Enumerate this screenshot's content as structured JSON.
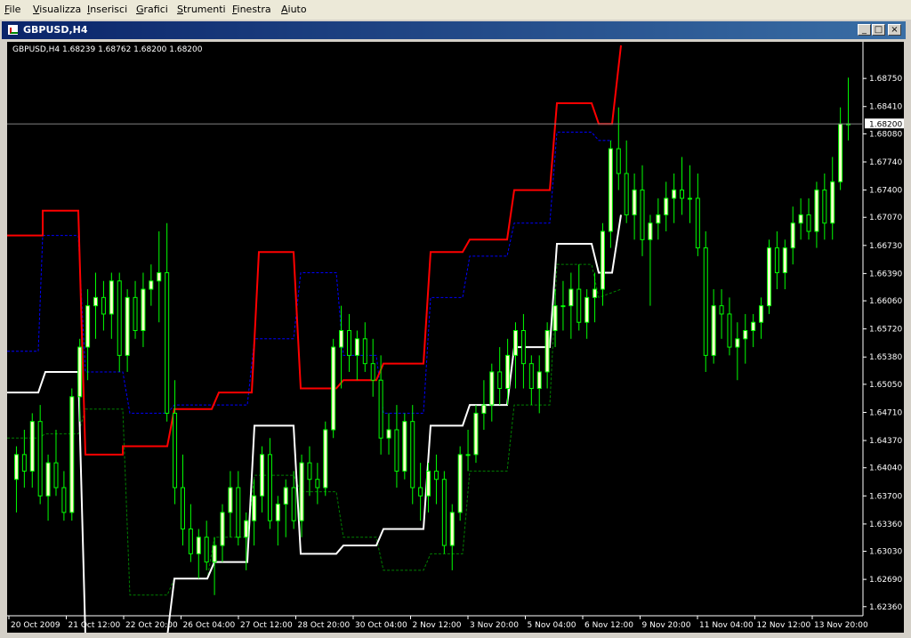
{
  "menu": [
    "File",
    "Visualizza",
    "Inserisci",
    "Grafici",
    "Strumenti",
    "Finestra",
    "Aiuto"
  ],
  "window": {
    "title": "GBPUSD,H4",
    "min": "_",
    "max": "□",
    "close": "×"
  },
  "colors": {
    "background": "#000000",
    "bull_candle": "#ffffcc",
    "candle_wick": "#00ff00",
    "upper_band": "#ff0000",
    "lower_band": "#ffffff",
    "mid_upper": "#0000ff",
    "mid_lower": "#008000"
  },
  "chart_data": {
    "type": "candlestick",
    "symbol": "GBPUSD",
    "timeframe": "H4",
    "info_text": "GBPUSD,H4  1.68239 1.68762 1.68200 1.68200",
    "current_price": "1.68200",
    "ylim": [
      1.6225,
      1.6915
    ],
    "y_ticks": [
      "1.68750",
      "1.68410",
      "1.68080",
      "1.67740",
      "1.67400",
      "1.67070",
      "1.66730",
      "1.66390",
      "1.66060",
      "1.65720",
      "1.65380",
      "1.65050",
      "1.64710",
      "1.64370",
      "1.64040",
      "1.63700",
      "1.63360",
      "1.63030",
      "1.62690",
      "1.62360"
    ],
    "x_ticks": [
      "20 Oct 2009",
      "21 Oct 12:00",
      "22 Oct 20:00",
      "26 Oct 04:00",
      "27 Oct 12:00",
      "28 Oct 20:00",
      "30 Oct 04:00",
      "2 Nov 12:00",
      "3 Nov 20:00",
      "5 Nov 04:00",
      "6 Nov 12:00",
      "9 Nov 20:00",
      "11 Nov 04:00",
      "12 Nov 12:00",
      "13 Nov 20:00"
    ],
    "candles": [
      [
        1.639,
        1.643,
        1.635,
        1.642
      ],
      [
        1.642,
        1.645,
        1.638,
        1.64
      ],
      [
        1.64,
        1.647,
        1.638,
        1.646
      ],
      [
        1.646,
        1.648,
        1.636,
        1.637
      ],
      [
        1.637,
        1.642,
        1.634,
        1.641
      ],
      [
        1.641,
        1.645,
        1.637,
        1.638
      ],
      [
        1.638,
        1.64,
        1.634,
        1.635
      ],
      [
        1.635,
        1.65,
        1.634,
        1.649
      ],
      [
        1.649,
        1.656,
        1.646,
        1.655
      ],
      [
        1.655,
        1.662,
        1.651,
        1.66
      ],
      [
        1.66,
        1.664,
        1.656,
        1.661
      ],
      [
        1.661,
        1.663,
        1.657,
        1.659
      ],
      [
        1.659,
        1.664,
        1.656,
        1.663
      ],
      [
        1.663,
        1.664,
        1.652,
        1.654
      ],
      [
        1.654,
        1.662,
        1.652,
        1.661
      ],
      [
        1.661,
        1.663,
        1.656,
        1.657
      ],
      [
        1.657,
        1.664,
        1.655,
        1.662
      ],
      [
        1.662,
        1.665,
        1.66,
        1.663
      ],
      [
        1.663,
        1.669,
        1.658,
        1.664
      ],
      [
        1.664,
        1.67,
        1.646,
        1.647
      ],
      [
        1.647,
        1.651,
        1.636,
        1.638
      ],
      [
        1.638,
        1.642,
        1.631,
        1.633
      ],
      [
        1.633,
        1.636,
        1.629,
        1.63
      ],
      [
        1.63,
        1.633,
        1.627,
        1.632
      ],
      [
        1.632,
        1.634,
        1.628,
        1.629
      ],
      [
        1.629,
        1.632,
        1.625,
        1.631
      ],
      [
        1.631,
        1.636,
        1.629,
        1.635
      ],
      [
        1.635,
        1.64,
        1.632,
        1.638
      ],
      [
        1.638,
        1.64,
        1.631,
        1.632
      ],
      [
        1.632,
        1.635,
        1.628,
        1.634
      ],
      [
        1.634,
        1.639,
        1.631,
        1.637
      ],
      [
        1.637,
        1.643,
        1.635,
        1.642
      ],
      [
        1.642,
        1.644,
        1.633,
        1.634
      ],
      [
        1.634,
        1.637,
        1.631,
        1.636
      ],
      [
        1.636,
        1.639,
        1.632,
        1.638
      ],
      [
        1.638,
        1.64,
        1.633,
        1.634
      ],
      [
        1.634,
        1.642,
        1.632,
        1.641
      ],
      [
        1.641,
        1.643,
        1.637,
        1.639
      ],
      [
        1.639,
        1.641,
        1.636,
        1.638
      ],
      [
        1.638,
        1.646,
        1.637,
        1.645
      ],
      [
        1.645,
        1.656,
        1.644,
        1.655
      ],
      [
        1.655,
        1.66,
        1.65,
        1.657
      ],
      [
        1.657,
        1.659,
        1.652,
        1.654
      ],
      [
        1.654,
        1.657,
        1.651,
        1.656
      ],
      [
        1.656,
        1.658,
        1.652,
        1.653
      ],
      [
        1.653,
        1.656,
        1.649,
        1.651
      ],
      [
        1.651,
        1.654,
        1.642,
        1.644
      ],
      [
        1.644,
        1.647,
        1.642,
        1.645
      ],
      [
        1.645,
        1.648,
        1.638,
        1.64
      ],
      [
        1.64,
        1.647,
        1.639,
        1.646
      ],
      [
        1.646,
        1.648,
        1.636,
        1.638
      ],
      [
        1.638,
        1.641,
        1.634,
        1.637
      ],
      [
        1.637,
        1.641,
        1.635,
        1.64
      ],
      [
        1.64,
        1.642,
        1.636,
        1.639
      ],
      [
        1.639,
        1.64,
        1.63,
        1.631
      ],
      [
        1.631,
        1.636,
        1.628,
        1.635
      ],
      [
        1.635,
        1.643,
        1.634,
        1.642
      ],
      [
        1.642,
        1.645,
        1.64,
        1.642
      ],
      [
        1.642,
        1.648,
        1.641,
        1.647
      ],
      [
        1.647,
        1.651,
        1.645,
        1.648
      ],
      [
        1.648,
        1.653,
        1.646,
        1.652
      ],
      [
        1.652,
        1.655,
        1.648,
        1.65
      ],
      [
        1.65,
        1.656,
        1.648,
        1.654
      ],
      [
        1.654,
        1.658,
        1.65,
        1.657
      ],
      [
        1.657,
        1.659,
        1.65,
        1.653
      ],
      [
        1.653,
        1.654,
        1.648,
        1.65
      ],
      [
        1.65,
        1.654,
        1.647,
        1.652
      ],
      [
        1.652,
        1.658,
        1.65,
        1.657
      ],
      [
        1.657,
        1.662,
        1.655,
        1.66
      ],
      [
        1.66,
        1.663,
        1.657,
        1.66
      ],
      [
        1.66,
        1.664,
        1.656,
        1.662
      ],
      [
        1.662,
        1.665,
        1.657,
        1.658
      ],
      [
        1.658,
        1.662,
        1.656,
        1.661
      ],
      [
        1.661,
        1.664,
        1.658,
        1.662
      ],
      [
        1.662,
        1.67,
        1.66,
        1.669
      ],
      [
        1.669,
        1.68,
        1.667,
        1.679
      ],
      [
        1.679,
        1.684,
        1.674,
        1.676
      ],
      [
        1.676,
        1.68,
        1.67,
        1.671
      ],
      [
        1.671,
        1.676,
        1.668,
        1.674
      ],
      [
        1.674,
        1.677,
        1.666,
        1.668
      ],
      [
        1.668,
        1.671,
        1.66,
        1.67
      ],
      [
        1.67,
        1.673,
        1.668,
        1.671
      ],
      [
        1.671,
        1.675,
        1.669,
        1.673
      ],
      [
        1.673,
        1.676,
        1.67,
        1.674
      ],
      [
        1.674,
        1.678,
        1.671,
        1.673
      ],
      [
        1.673,
        1.677,
        1.67,
        1.673
      ],
      [
        1.673,
        1.676,
        1.666,
        1.667
      ],
      [
        1.667,
        1.669,
        1.652,
        1.654
      ],
      [
        1.654,
        1.662,
        1.653,
        1.66
      ],
      [
        1.66,
        1.662,
        1.656,
        1.659
      ],
      [
        1.659,
        1.661,
        1.654,
        1.655
      ],
      [
        1.655,
        1.658,
        1.651,
        1.656
      ],
      [
        1.656,
        1.659,
        1.653,
        1.657
      ],
      [
        1.657,
        1.659,
        1.655,
        1.658
      ],
      [
        1.658,
        1.661,
        1.656,
        1.66
      ],
      [
        1.66,
        1.668,
        1.659,
        1.667
      ],
      [
        1.667,
        1.669,
        1.662,
        1.664
      ],
      [
        1.664,
        1.668,
        1.662,
        1.667
      ],
      [
        1.667,
        1.672,
        1.665,
        1.67
      ],
      [
        1.67,
        1.673,
        1.668,
        1.671
      ],
      [
        1.671,
        1.673,
        1.668,
        1.669
      ],
      [
        1.669,
        1.675,
        1.667,
        1.674
      ],
      [
        1.674,
        1.676,
        1.668,
        1.67
      ],
      [
        1.67,
        1.678,
        1.668,
        1.675
      ],
      [
        1.675,
        1.684,
        1.674,
        1.682
      ],
      [
        1.682,
        1.6876,
        1.68,
        1.682
      ]
    ],
    "upper_band": [
      [
        0,
        1.6685
      ],
      [
        40,
        1.6685
      ],
      [
        40,
        1.6715
      ],
      [
        80,
        1.6715
      ],
      [
        88,
        1.642
      ],
      [
        130,
        1.642
      ],
      [
        130,
        1.643
      ],
      [
        180,
        1.643
      ],
      [
        188,
        1.6475
      ],
      [
        230,
        1.6475
      ],
      [
        238,
        1.6495
      ],
      [
        275,
        1.6495
      ],
      [
        283,
        1.6665
      ],
      [
        322,
        1.6665
      ],
      [
        330,
        1.65
      ],
      [
        370,
        1.65
      ],
      [
        378,
        1.651
      ],
      [
        415,
        1.651
      ],
      [
        423,
        1.653
      ],
      [
        468,
        1.653
      ],
      [
        476,
        1.6665
      ],
      [
        512,
        1.6665
      ],
      [
        520,
        1.668
      ],
      [
        562,
        1.668
      ],
      [
        570,
        1.674
      ],
      [
        610,
        1.674
      ],
      [
        618,
        1.6845
      ],
      [
        657,
        1.6845
      ],
      [
        665,
        1.682
      ],
      [
        680,
        1.682
      ],
      [
        690,
        1.6915
      ]
    ],
    "lower_band": [
      [
        0,
        1.6495
      ],
      [
        35,
        1.6495
      ],
      [
        43,
        1.652
      ],
      [
        80,
        1.652
      ],
      [
        88,
        1.62
      ],
      [
        180,
        1.62
      ],
      [
        188,
        1.627
      ],
      [
        225,
        1.627
      ],
      [
        233,
        1.629
      ],
      [
        270,
        1.629
      ],
      [
        278,
        1.6455
      ],
      [
        322,
        1.6455
      ],
      [
        330,
        1.63
      ],
      [
        370,
        1.63
      ],
      [
        378,
        1.631
      ],
      [
        415,
        1.631
      ],
      [
        423,
        1.633
      ],
      [
        468,
        1.633
      ],
      [
        476,
        1.6455
      ],
      [
        512,
        1.6455
      ],
      [
        520,
        1.648
      ],
      [
        562,
        1.648
      ],
      [
        570,
        1.655
      ],
      [
        610,
        1.655
      ],
      [
        618,
        1.6675
      ],
      [
        657,
        1.6675
      ],
      [
        665,
        1.664
      ],
      [
        680,
        1.664
      ],
      [
        690,
        1.671
      ]
    ],
    "mid_upper": [
      [
        0,
        1.6545
      ],
      [
        35,
        1.6545
      ],
      [
        40,
        1.6685
      ],
      [
        80,
        1.6685
      ],
      [
        88,
        1.652
      ],
      [
        130,
        1.652
      ],
      [
        138,
        1.647
      ],
      [
        180,
        1.647
      ],
      [
        188,
        1.648
      ],
      [
        270,
        1.648
      ],
      [
        278,
        1.656
      ],
      [
        322,
        1.656
      ],
      [
        330,
        1.664
      ],
      [
        370,
        1.664
      ],
      [
        378,
        1.654
      ],
      [
        415,
        1.654
      ],
      [
        423,
        1.647
      ],
      [
        468,
        1.647
      ],
      [
        476,
        1.661
      ],
      [
        512,
        1.661
      ],
      [
        520,
        1.666
      ],
      [
        562,
        1.666
      ],
      [
        570,
        1.67
      ],
      [
        610,
        1.67
      ],
      [
        618,
        1.681
      ],
      [
        657,
        1.681
      ],
      [
        665,
        1.68
      ],
      [
        680,
        1.68
      ]
    ],
    "mid_lower": [
      [
        0,
        1.644
      ],
      [
        35,
        1.644
      ],
      [
        43,
        1.6445
      ],
      [
        80,
        1.6445
      ],
      [
        88,
        1.6475
      ],
      [
        130,
        1.6475
      ],
      [
        138,
        1.625
      ],
      [
        180,
        1.625
      ],
      [
        188,
        1.627
      ],
      [
        225,
        1.627
      ],
      [
        233,
        1.632
      ],
      [
        270,
        1.632
      ],
      [
        278,
        1.6395
      ],
      [
        322,
        1.6395
      ],
      [
        330,
        1.6375
      ],
      [
        370,
        1.6375
      ],
      [
        378,
        1.632
      ],
      [
        415,
        1.632
      ],
      [
        423,
        1.628
      ],
      [
        468,
        1.628
      ],
      [
        476,
        1.63
      ],
      [
        512,
        1.63
      ],
      [
        520,
        1.64
      ],
      [
        562,
        1.64
      ],
      [
        570,
        1.648
      ],
      [
        610,
        1.648
      ],
      [
        618,
        1.665
      ],
      [
        657,
        1.665
      ],
      [
        665,
        1.661
      ],
      [
        690,
        1.662
      ]
    ]
  }
}
